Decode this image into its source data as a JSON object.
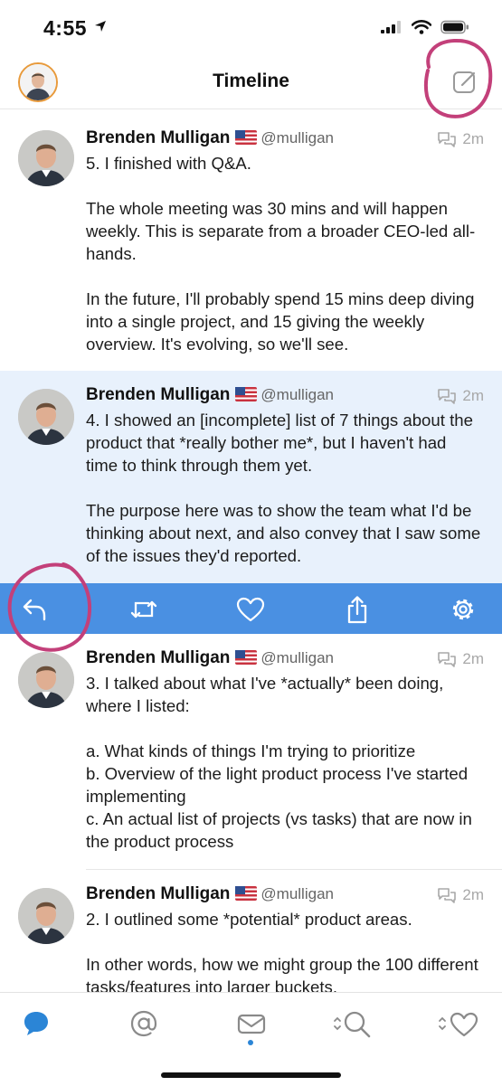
{
  "status_bar": {
    "time": "4:55"
  },
  "nav": {
    "title": "Timeline"
  },
  "colors": {
    "accent": "#4a90e2",
    "selected_bg": "#e8f1fc",
    "annotation": "#c3407a",
    "avatar_ring": "#e89a3b"
  },
  "tweets": [
    {
      "author": "Brenden Mulligan",
      "handle": "@mulligan",
      "time": "2m",
      "text": "5. I finished with Q&A.\n\nThe whole meeting was 30 mins and will happen weekly. This is separate from a broader CEO-led all-hands.\n\nIn the future, I'll probably spend 15 mins deep diving into a single project, and 15 giving the weekly overview. It's evolving, so we'll see."
    },
    {
      "author": "Brenden Mulligan",
      "handle": "@mulligan",
      "time": "2m",
      "selected": true,
      "text": "4. I showed an [incomplete] list of 7 things about the product that *really bother me*, but I haven't had time to think through them yet.\n\nThe purpose here was to show the team what I'd be thinking about next, and also convey that I saw some of the issues they'd reported."
    },
    {
      "author": "Brenden Mulligan",
      "handle": "@mulligan",
      "time": "2m",
      "text": "3. I talked about what I've *actually* been doing, where I listed:\n\na. What kinds of things I'm trying to prioritize\nb. Overview of the light product process I've started implementing\nc. An actual list of projects (vs tasks) that are now in the product process"
    },
    {
      "author": "Brenden Mulligan",
      "handle": "@mulligan",
      "time": "2m",
      "text": "2. I outlined some *potential* product areas.\n\nIn other words, how we might group the 100 different tasks/features into larger buckets."
    }
  ],
  "actions": {
    "items": [
      {
        "icon": "reply-icon"
      },
      {
        "icon": "retweet-icon"
      },
      {
        "icon": "heart-icon"
      },
      {
        "icon": "share-icon"
      },
      {
        "icon": "gear-icon"
      }
    ]
  },
  "tabs": {
    "items": [
      {
        "icon": "timeline-icon",
        "active": true
      },
      {
        "icon": "mentions-icon"
      },
      {
        "icon": "messages-icon"
      },
      {
        "icon": "search-icon"
      },
      {
        "icon": "likes-icon"
      }
    ]
  }
}
